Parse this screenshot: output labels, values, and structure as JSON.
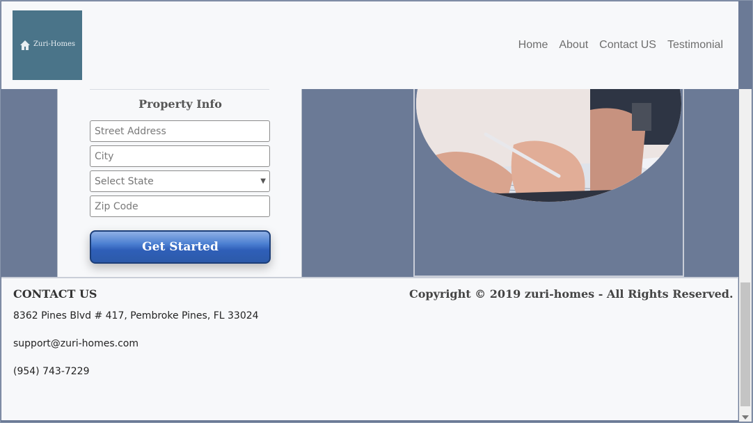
{
  "brand": {
    "name": "Zuri-Homes",
    "logo_bg": "#4a7489",
    "icon": "home-icon"
  },
  "nav": {
    "items": [
      "Home",
      "About",
      "Contact US",
      "Testimonial"
    ]
  },
  "form": {
    "title": "Property Info",
    "street_placeholder": "Street Address",
    "city_placeholder": "City",
    "state_selected": "Select State",
    "zip_placeholder": "Zip Code",
    "submit_label": "Get Started"
  },
  "footer": {
    "contact_heading": "CONTACT US",
    "address": "8362 Pines Blvd # 417, Pembroke Pines, FL 33024",
    "email": "support@zuri-homes.com",
    "phone": "(954) 743-7229",
    "copyright": "Copyright © 2019 zuri-homes - All Rights Reserved."
  },
  "colors": {
    "page_bg": "#6b7a96",
    "panel_bg": "#f7f8fa",
    "button_blue": "#2f5fb8"
  }
}
